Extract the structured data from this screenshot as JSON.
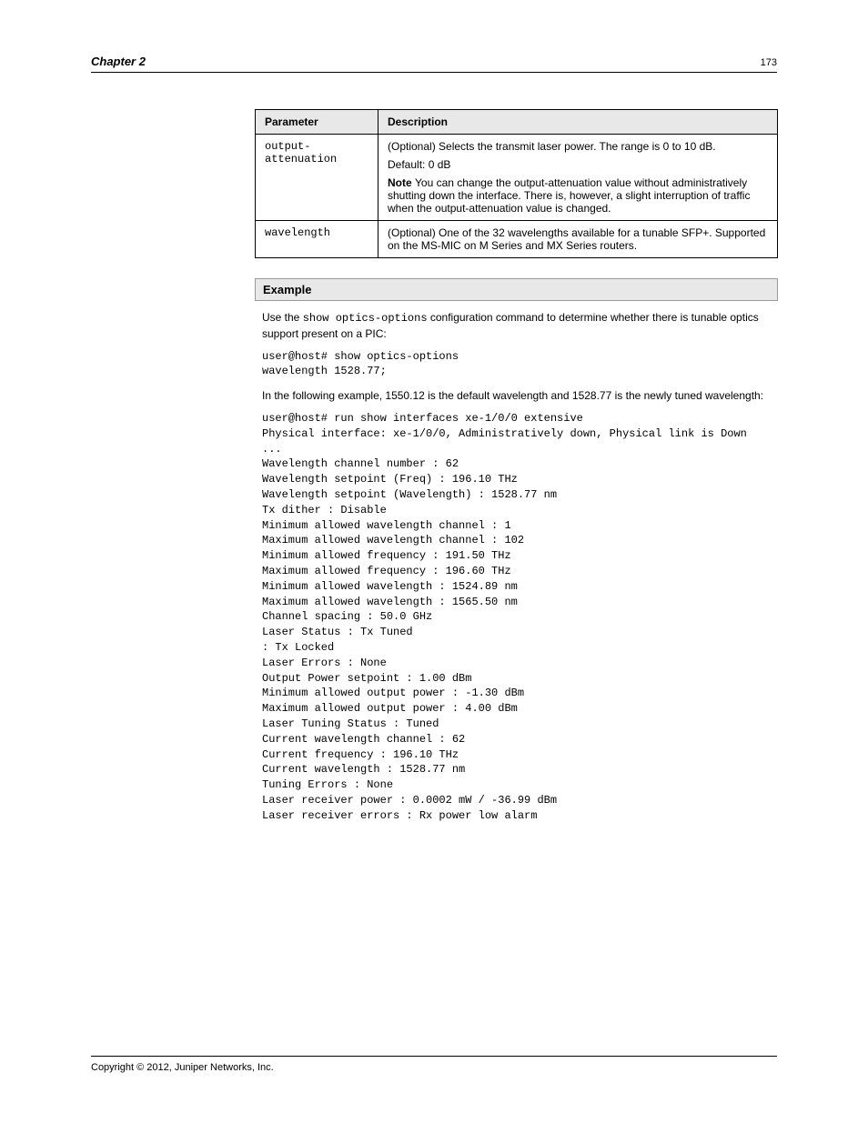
{
  "header": {
    "left": "Chapter 2",
    "right": "173"
  },
  "table": {
    "columns": [
      "Parameter",
      "Description"
    ],
    "rows": [
      {
        "param": "output-attenuation",
        "desc": [
          {
            "text": "(Optional) Selects the transmit laser power. The range is 0 to 10 dB.",
            "class": ""
          },
          {
            "text": "Default: 0 dB",
            "class": ""
          },
          {
            "prefix": "Note",
            "text": "You can change the output-attenuation value without administratively shutting down the interface. There is, however, a slight interruption of traffic when the output-attenuation value is changed.",
            "class": ""
          }
        ]
      },
      {
        "param": "wavelength",
        "desc": [
          {
            "text": "(Optional) One of the 32 wavelengths available for a tunable SFP+. Supported on the MS-MIC on M Series and MX Series routers.",
            "class": ""
          }
        ]
      }
    ]
  },
  "example": {
    "title": "Example",
    "para1_prefix": "Use the ",
    "para1_code": "show optics-options",
    "para1_suffix": " configuration command to determine whether there is tunable optics support present on a PIC:",
    "snippet1_lines": [
      "user@host# show optics-options",
      "wavelength 1528.77;"
    ],
    "para2": "In the following example, 1550.12 is the default wavelength and 1528.77 is the newly tuned wavelength:",
    "snippet2_lines": [
      "user@host# run show interfaces xe-1/0/0 extensive",
      "Physical interface: xe-1/0/0, Administratively down, Physical link is Down",
      "...",
      "  Wavelength channel number            : 62",
      "  Wavelength setpoint (Freq)           : 196.10 THz",
      "  Wavelength setpoint (Wavelength)     : 1528.77 nm",
      "  Tx dither                            : Disable",
      "  Minimum allowed wavelength channel   : 1",
      "  Maximum allowed wavelength channel   : 102",
      "  Minimum allowed frequency            : 191.50 THz",
      "  Maximum allowed frequency            : 196.60 THz",
      "  Minimum allowed wavelength           : 1524.89 nm",
      "  Maximum allowed wavelength           : 1565.50 nm",
      "  Channel spacing                      : 50.0  GHz",
      "  Laser Status                         : Tx Tuned",
      "                                       : Tx Locked",
      "  Laser Errors                         : None",
      "  Output Power setpoint                : 1.00 dBm",
      "  Minimum allowed output power         : -1.30 dBm",
      "  Maximum allowed output power         : 4.00 dBm",
      "  Laser Tuning Status                  : Tuned",
      "  Current wavelength channel           : 62",
      "  Current frequency                    : 196.10 THz",
      "  Current wavelength                   : 1528.77 nm",
      "  Tuning Errors                        : None",
      "  Laser receiver power                 : 0.0002 mW / -36.99 dBm",
      "  Laser receiver errors                : Rx power low alarm"
    ]
  },
  "footer": {
    "left": "Copyright © 2012, Juniper Networks, Inc.",
    "right": ""
  }
}
